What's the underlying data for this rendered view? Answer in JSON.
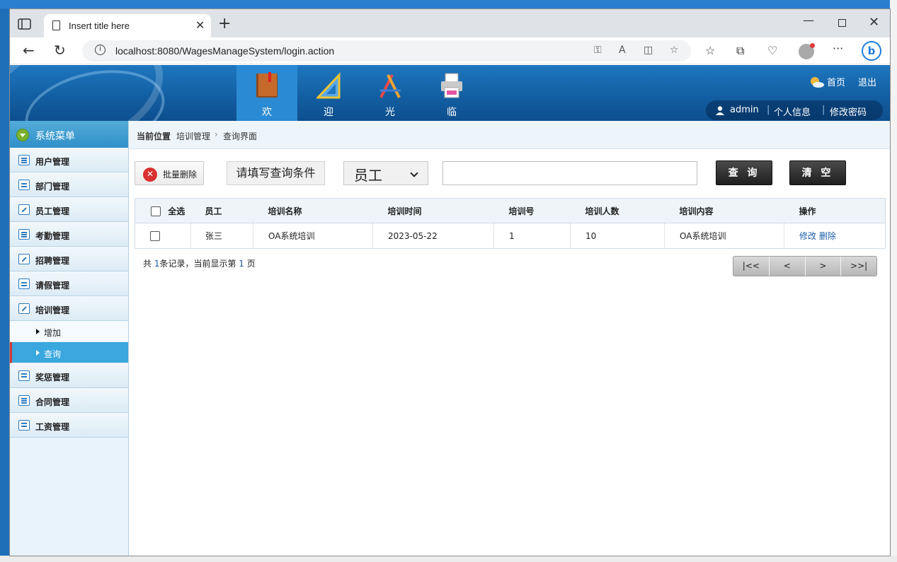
{
  "browser": {
    "tab_title": "Insert title here",
    "url": "localhost:8080/WagesManageSystem/login.action"
  },
  "header": {
    "nav": [
      {
        "label": "欢",
        "icon": "book-icon"
      },
      {
        "label": "迎",
        "icon": "ruler-triangle-icon"
      },
      {
        "label": "光",
        "icon": "drawing-tools-icon"
      },
      {
        "label": "临",
        "icon": "printer-icon"
      }
    ],
    "home_link": "首页",
    "logout_link": "退出",
    "user_name": "admin",
    "profile_link": "个人信息",
    "password_link": "修改密码",
    "separator": "|"
  },
  "sidebar": {
    "title": "系统菜单",
    "menu": [
      {
        "label": "用户管理"
      },
      {
        "label": "部门管理"
      },
      {
        "label": "员工管理"
      },
      {
        "label": "考勤管理"
      },
      {
        "label": "招聘管理"
      },
      {
        "label": "请假管理"
      },
      {
        "label": "培训管理"
      }
    ],
    "submenu": [
      {
        "label": "增加"
      },
      {
        "label": "查询"
      }
    ],
    "menu_after": [
      {
        "label": "奖惩管理"
      },
      {
        "label": "合同管理"
      },
      {
        "label": "工资管理"
      }
    ]
  },
  "breadcrumb": {
    "lead": "当前位置",
    "level1": "培训管理",
    "sep": "›",
    "level2": "查询界面"
  },
  "toolbar": {
    "batch_delete": "批量删除",
    "condition_label": "请填写查询条件",
    "select_value": "员工",
    "search_value": "",
    "query_button": "查 询",
    "clear_button": "清 空"
  },
  "table": {
    "select_all": "全选",
    "columns": [
      "员工",
      "培训名称",
      "培训时间",
      "培训号",
      "培训人数",
      "培训内容",
      "操作"
    ],
    "rows": [
      {
        "employee": "张三",
        "training_name": "OA系统培训",
        "training_time": "2023-05-22",
        "training_no": "1",
        "headcount": "10",
        "content": "OA系统培训",
        "edit": "修改",
        "delete": "删除"
      }
    ]
  },
  "pagination": {
    "prefix": "共 ",
    "total": "1",
    "middle": "条记录，当前显示第 ",
    "page": "1",
    "suffix": " 页",
    "first": "|<<",
    "prev": "<",
    "next": ">",
    "last": ">>|"
  },
  "colors": {
    "header_blue": "#135fa3",
    "active_sub": "#3aa7de",
    "link_blue": "#1d5fa8"
  }
}
